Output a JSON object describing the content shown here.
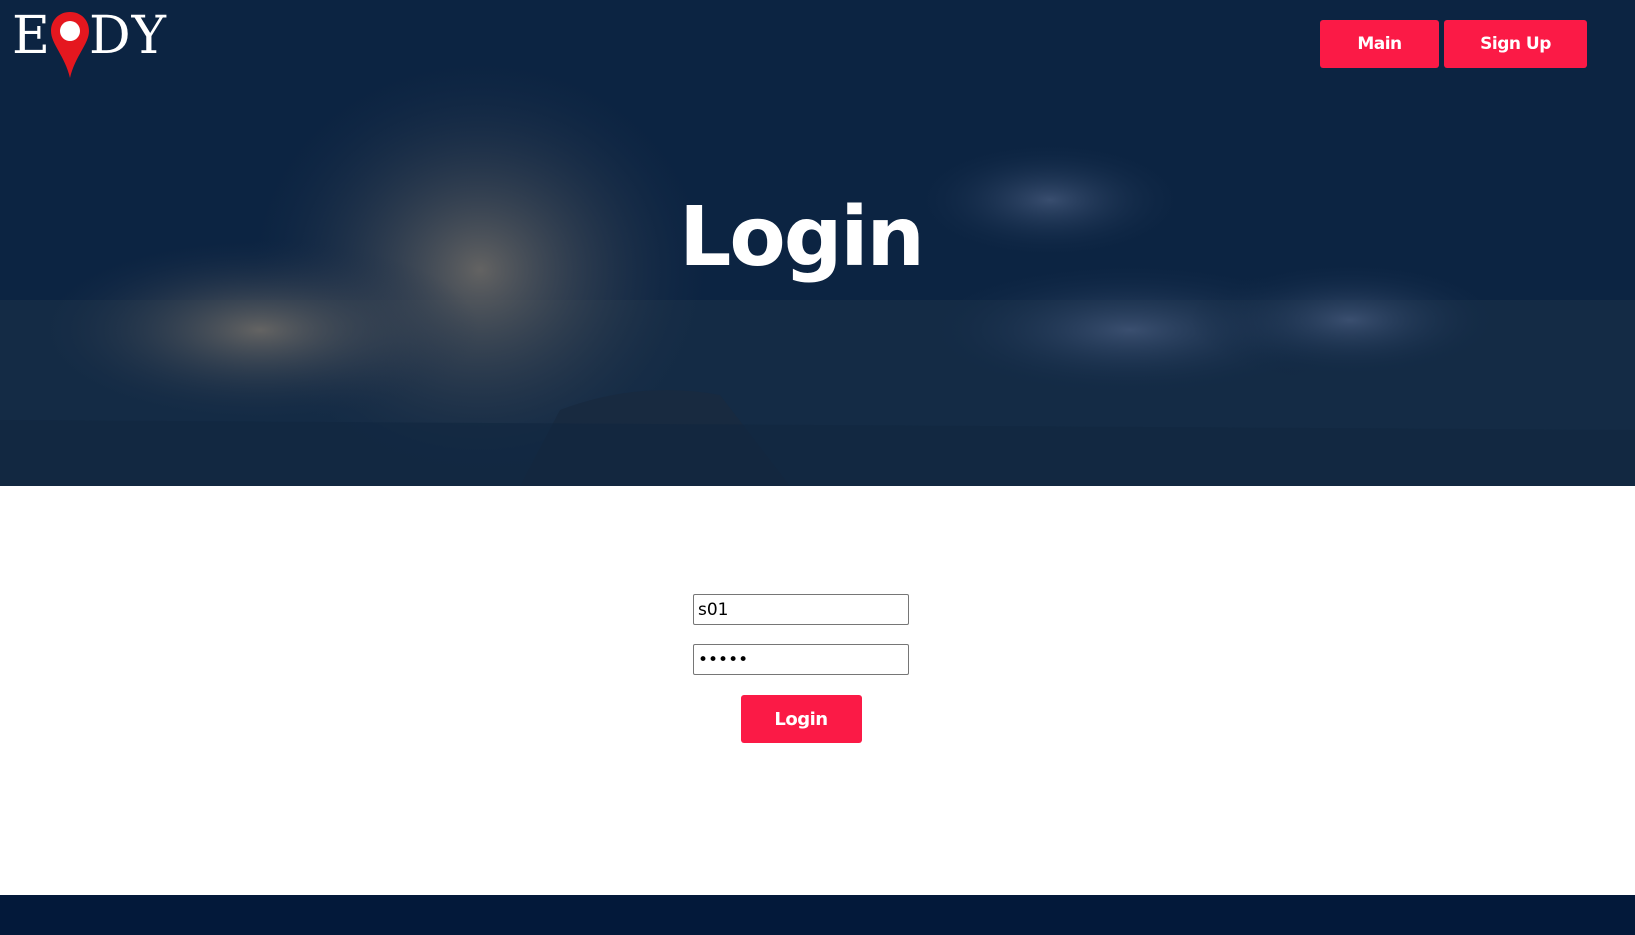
{
  "logo": {
    "text_left": "E",
    "text_right": "DY",
    "pin_icon": "map-pin-icon",
    "pin_color": "#e5171f"
  },
  "nav": {
    "main_label": "Main",
    "signup_label": "Sign Up"
  },
  "hero": {
    "title": "Login"
  },
  "form": {
    "username_value": "s01",
    "password_value": "•••••",
    "submit_label": "Login"
  },
  "colors": {
    "accent": "#fb1a46",
    "hero_overlay": "#0b2340",
    "footer": "#03193a"
  }
}
